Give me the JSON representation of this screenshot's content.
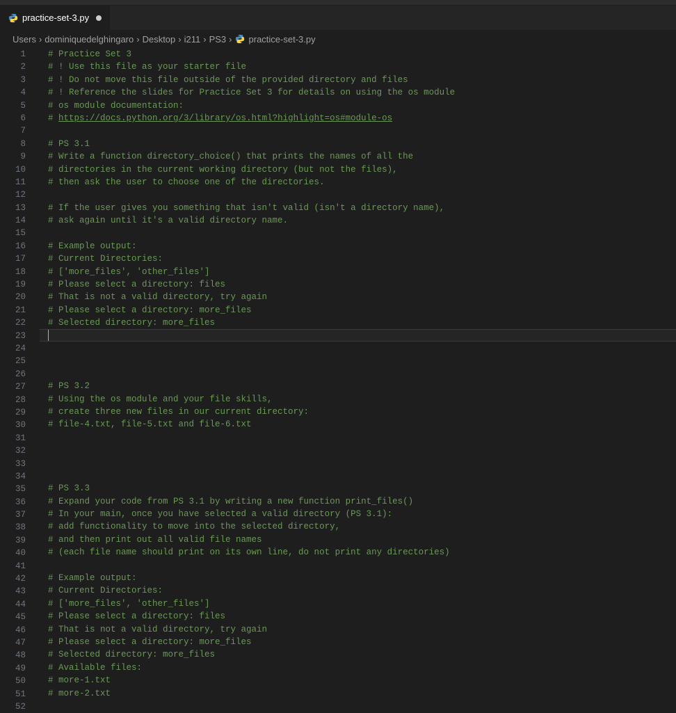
{
  "tab": {
    "filename": "practice-set-3.py",
    "dirty": true
  },
  "breadcrumbs": {
    "items": [
      "Users",
      "dominiquedelghingaro",
      "Desktop",
      "i211",
      "PS3"
    ],
    "file": "practice-set-3.py"
  },
  "activeLine": 23,
  "code": {
    "lines": [
      {
        "n": 1,
        "t": "# Practice Set 3",
        "c": "comment"
      },
      {
        "n": 2,
        "t": "# ! Use this file as your starter file",
        "c": "comment"
      },
      {
        "n": 3,
        "t": "# ! Do not move this file outside of the provided directory and files",
        "c": "comment"
      },
      {
        "n": 4,
        "t": "# ! Reference the slides for Practice Set 3 for details on using the os module",
        "c": "comment"
      },
      {
        "n": 5,
        "t": "# os module documentation:",
        "c": "comment"
      },
      {
        "n": 6,
        "pre": "# ",
        "url": "https://docs.python.org/3/library/os.html?highlight=os#module-os",
        "c": "url"
      },
      {
        "n": 7,
        "t": "",
        "c": ""
      },
      {
        "n": 8,
        "t": "# PS 3.1",
        "c": "comment"
      },
      {
        "n": 9,
        "t": "# Write a function directory_choice() that prints the names of all the",
        "c": "comment"
      },
      {
        "n": 10,
        "t": "# directories in the current working directory (but not the files),",
        "c": "comment"
      },
      {
        "n": 11,
        "t": "# then ask the user to choose one of the directories.",
        "c": "comment"
      },
      {
        "n": 12,
        "t": "",
        "c": ""
      },
      {
        "n": 13,
        "t": "# If the user gives you something that isn't valid (isn't a directory name),",
        "c": "comment"
      },
      {
        "n": 14,
        "t": "# ask again until it's a valid directory name.",
        "c": "comment"
      },
      {
        "n": 15,
        "t": "",
        "c": ""
      },
      {
        "n": 16,
        "t": "# Example output:",
        "c": "comment"
      },
      {
        "n": 17,
        "t": "# Current Directories:",
        "c": "comment"
      },
      {
        "n": 18,
        "t": "# ['more_files', 'other_files']",
        "c": "comment"
      },
      {
        "n": 19,
        "t": "# Please select a directory: files",
        "c": "comment"
      },
      {
        "n": 20,
        "t": "# That is not a valid directory, try again",
        "c": "comment"
      },
      {
        "n": 21,
        "t": "# Please select a directory: more_files",
        "c": "comment"
      },
      {
        "n": 22,
        "t": "# Selected directory: more_files",
        "c": "comment"
      },
      {
        "n": 23,
        "t": "",
        "c": "",
        "active": true
      },
      {
        "n": 24,
        "t": "",
        "c": ""
      },
      {
        "n": 25,
        "t": "",
        "c": ""
      },
      {
        "n": 26,
        "t": "",
        "c": ""
      },
      {
        "n": 27,
        "t": "# PS 3.2",
        "c": "comment"
      },
      {
        "n": 28,
        "t": "# Using the os module and your file skills,",
        "c": "comment"
      },
      {
        "n": 29,
        "t": "# create three new files in our current directory:",
        "c": "comment"
      },
      {
        "n": 30,
        "t": "# file-4.txt, file-5.txt and file-6.txt",
        "c": "comment"
      },
      {
        "n": 31,
        "t": "",
        "c": ""
      },
      {
        "n": 32,
        "t": "",
        "c": ""
      },
      {
        "n": 33,
        "t": "",
        "c": ""
      },
      {
        "n": 34,
        "t": "",
        "c": ""
      },
      {
        "n": 35,
        "t": "# PS 3.3",
        "c": "comment"
      },
      {
        "n": 36,
        "t": "# Expand your code from PS 3.1 by writing a new function print_files()",
        "c": "comment"
      },
      {
        "n": 37,
        "t": "# In your main, once you have selected a valid directory (PS 3.1):",
        "c": "comment"
      },
      {
        "n": 38,
        "t": "# add functionality to move into the selected directory,",
        "c": "comment"
      },
      {
        "n": 39,
        "t": "# and then print out all valid file names",
        "c": "comment"
      },
      {
        "n": 40,
        "t": "# (each file name should print on its own line, do not print any directories)",
        "c": "comment"
      },
      {
        "n": 41,
        "t": "",
        "c": ""
      },
      {
        "n": 42,
        "t": "# Example output:",
        "c": "comment"
      },
      {
        "n": 43,
        "t": "# Current Directories:",
        "c": "comment"
      },
      {
        "n": 44,
        "t": "# ['more_files', 'other_files']",
        "c": "comment"
      },
      {
        "n": 45,
        "t": "# Please select a directory: files",
        "c": "comment"
      },
      {
        "n": 46,
        "t": "# That is not a valid directory, try again",
        "c": "comment"
      },
      {
        "n": 47,
        "t": "# Please select a directory: more_files",
        "c": "comment"
      },
      {
        "n": 48,
        "t": "# Selected directory: more_files",
        "c": "comment"
      },
      {
        "n": 49,
        "t": "# Available files:",
        "c": "comment"
      },
      {
        "n": 50,
        "t": "# more-1.txt",
        "c": "comment"
      },
      {
        "n": 51,
        "t": "# more-2.txt",
        "c": "comment"
      },
      {
        "n": 52,
        "t": "",
        "c": ""
      }
    ]
  }
}
